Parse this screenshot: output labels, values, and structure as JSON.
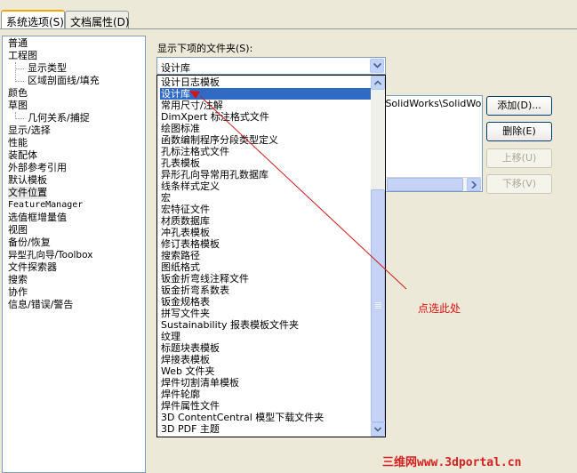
{
  "tabs": [
    {
      "label": "系统选项(S)"
    },
    {
      "label": "文档属性(D)"
    }
  ],
  "tree": {
    "items": [
      {
        "label": "普通"
      },
      {
        "label": "工程图"
      },
      {
        "label": "显示类型"
      },
      {
        "label": "区域剖面线/填充"
      },
      {
        "label": "颜色"
      },
      {
        "label": "草图"
      },
      {
        "label": "几何关系/捕捉"
      },
      {
        "label": "显示/选择"
      },
      {
        "label": "性能"
      },
      {
        "label": "装配体"
      },
      {
        "label": "外部参考引用"
      },
      {
        "label": "默认模板"
      },
      {
        "label": "文件位置"
      },
      {
        "label": "FeatureManager"
      },
      {
        "label": "选值框增量值"
      },
      {
        "label": "视图"
      },
      {
        "label": "备份/恢复"
      },
      {
        "label": "异型孔向导/Toolbox"
      },
      {
        "label": "文件探索器"
      },
      {
        "label": "搜索"
      },
      {
        "label": "协作"
      },
      {
        "label": "信息/错误/警告"
      }
    ]
  },
  "main": {
    "show_folders_label": "显示下项的文件夹(S):",
    "combo_value": "设计库",
    "folder_path_visible": "a\\SolidWorks\\SolidWor"
  },
  "buttons": {
    "add": "添加(D)...",
    "delete": "删除(E)",
    "move_up": "上移(U)",
    "move_down": "下移(V)"
  },
  "dropdown": {
    "items": [
      "设计日志模板",
      "设计库",
      "常用尺寸/注解",
      "DimXpert 标注格式文件",
      "绘图标准",
      "函数编制程序分段类型定义",
      "孔标注格式文件",
      "孔表模板",
      "异形孔向导常用孔数据库",
      "线条样式定义",
      "宏",
      "宏特征文件",
      "材质数据库",
      "冲孔表模板",
      "修订表格模板",
      "搜索路径",
      "图纸格式",
      "钣金折弯线注释文件",
      "钣金折弯系数表",
      "钣金规格表",
      "拼写文件夹",
      "Sustainability 报表模板文件夹",
      "纹理",
      "标题块表模板",
      "焊接表模板",
      "Web 文件夹",
      "焊件切割清单模板",
      "焊件轮廓",
      "焊件属性文件",
      "3D ContentCentral 模型下载文件夹",
      "3D PDF 主题"
    ],
    "highlighted_index": 1
  },
  "annotation": {
    "text": "点选此处",
    "color": "#e01010"
  },
  "watermark": {
    "text": "三维网www.3dportal.cn"
  },
  "colors": {
    "highlight": "#316ac5",
    "tab_accent": "#f0a800",
    "background": "#ece9d8"
  }
}
